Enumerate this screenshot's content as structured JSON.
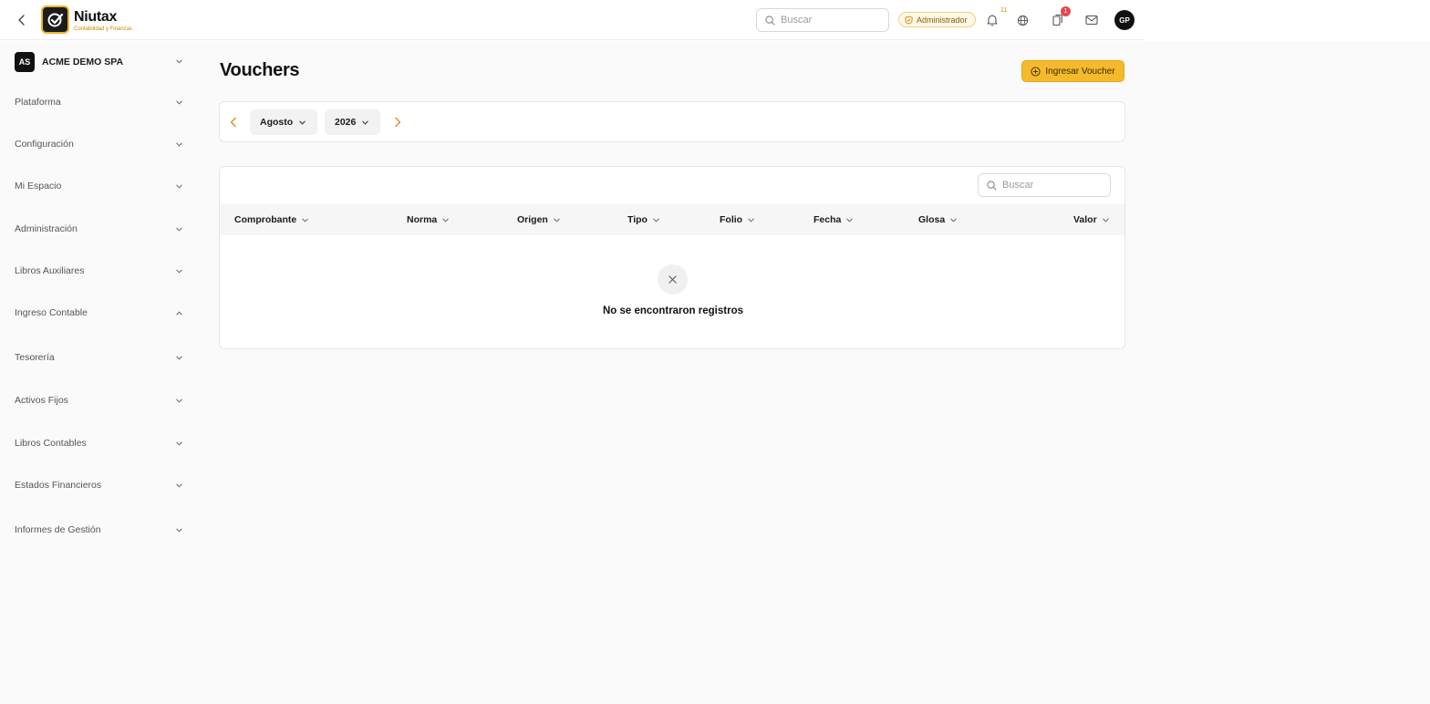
{
  "app": {
    "name": "Niutax",
    "tagline": "Contabilidad y Finanzas"
  },
  "header": {
    "search_placeholder": "Buscar",
    "role_badge": "Administrador",
    "notifications_count": "11",
    "alerts_count": "1",
    "avatar_initials": "GP"
  },
  "sidebar": {
    "company": {
      "initials": "AS",
      "name": "ACME DEMO SPA"
    },
    "items": [
      {
        "label": "Plataforma",
        "expanded": false
      },
      {
        "label": "Configuración",
        "expanded": false
      },
      {
        "label": "Mi Espacio",
        "expanded": false
      },
      {
        "label": "Administración",
        "expanded": false
      },
      {
        "label": "Libros Auxiliares",
        "expanded": false
      },
      {
        "label": "Ingreso Contable",
        "expanded": true
      },
      {
        "label": "Tesorería",
        "expanded": false
      },
      {
        "label": "Activos Fijos",
        "expanded": false
      },
      {
        "label": "Libros Contables",
        "expanded": false
      },
      {
        "label": "Estados Financieros",
        "expanded": false
      },
      {
        "label": "Informes de Gestión",
        "expanded": false
      }
    ]
  },
  "main": {
    "title": "Vouchers",
    "primary_action": "Ingresar Voucher",
    "filters": {
      "month": "Agosto",
      "year": "2026"
    },
    "table": {
      "search_placeholder": "Buscar",
      "columns": [
        "Comprobante",
        "Norma",
        "Origen",
        "Tipo",
        "Folio",
        "Fecha",
        "Glosa",
        "Valor"
      ],
      "rows": [],
      "empty_message": "No se encontraron registros"
    }
  },
  "colors": {
    "accent": "#f4b92c",
    "brand_dark": "#1c1c1c",
    "arrow": "#e08a1e",
    "badge_red": "#e5484d"
  }
}
